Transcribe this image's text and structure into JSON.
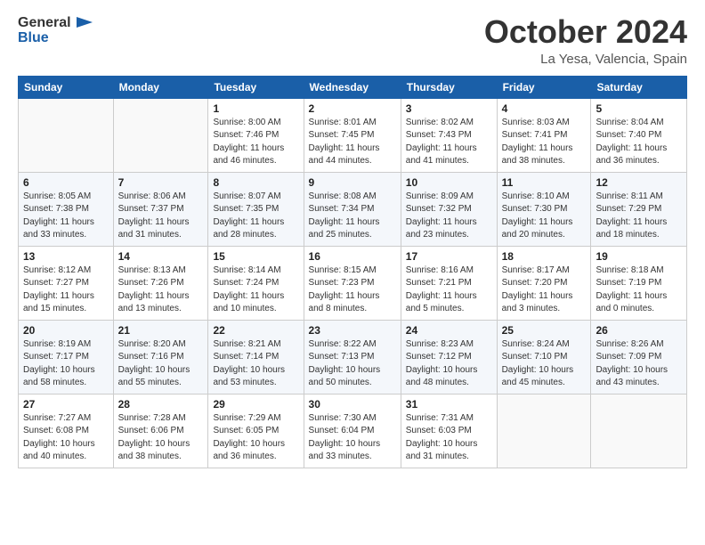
{
  "header": {
    "logo_general": "General",
    "logo_blue": "Blue",
    "month_title": "October 2024",
    "location": "La Yesa, Valencia, Spain"
  },
  "days_of_week": [
    "Sunday",
    "Monday",
    "Tuesday",
    "Wednesday",
    "Thursday",
    "Friday",
    "Saturday"
  ],
  "weeks": [
    [
      {
        "day": "",
        "info": ""
      },
      {
        "day": "",
        "info": ""
      },
      {
        "day": "1",
        "info": "Sunrise: 8:00 AM\nSunset: 7:46 PM\nDaylight: 11 hours\nand 46 minutes."
      },
      {
        "day": "2",
        "info": "Sunrise: 8:01 AM\nSunset: 7:45 PM\nDaylight: 11 hours\nand 44 minutes."
      },
      {
        "day": "3",
        "info": "Sunrise: 8:02 AM\nSunset: 7:43 PM\nDaylight: 11 hours\nand 41 minutes."
      },
      {
        "day": "4",
        "info": "Sunrise: 8:03 AM\nSunset: 7:41 PM\nDaylight: 11 hours\nand 38 minutes."
      },
      {
        "day": "5",
        "info": "Sunrise: 8:04 AM\nSunset: 7:40 PM\nDaylight: 11 hours\nand 36 minutes."
      }
    ],
    [
      {
        "day": "6",
        "info": "Sunrise: 8:05 AM\nSunset: 7:38 PM\nDaylight: 11 hours\nand 33 minutes."
      },
      {
        "day": "7",
        "info": "Sunrise: 8:06 AM\nSunset: 7:37 PM\nDaylight: 11 hours\nand 31 minutes."
      },
      {
        "day": "8",
        "info": "Sunrise: 8:07 AM\nSunset: 7:35 PM\nDaylight: 11 hours\nand 28 minutes."
      },
      {
        "day": "9",
        "info": "Sunrise: 8:08 AM\nSunset: 7:34 PM\nDaylight: 11 hours\nand 25 minutes."
      },
      {
        "day": "10",
        "info": "Sunrise: 8:09 AM\nSunset: 7:32 PM\nDaylight: 11 hours\nand 23 minutes."
      },
      {
        "day": "11",
        "info": "Sunrise: 8:10 AM\nSunset: 7:30 PM\nDaylight: 11 hours\nand 20 minutes."
      },
      {
        "day": "12",
        "info": "Sunrise: 8:11 AM\nSunset: 7:29 PM\nDaylight: 11 hours\nand 18 minutes."
      }
    ],
    [
      {
        "day": "13",
        "info": "Sunrise: 8:12 AM\nSunset: 7:27 PM\nDaylight: 11 hours\nand 15 minutes."
      },
      {
        "day": "14",
        "info": "Sunrise: 8:13 AM\nSunset: 7:26 PM\nDaylight: 11 hours\nand 13 minutes."
      },
      {
        "day": "15",
        "info": "Sunrise: 8:14 AM\nSunset: 7:24 PM\nDaylight: 11 hours\nand 10 minutes."
      },
      {
        "day": "16",
        "info": "Sunrise: 8:15 AM\nSunset: 7:23 PM\nDaylight: 11 hours\nand 8 minutes."
      },
      {
        "day": "17",
        "info": "Sunrise: 8:16 AM\nSunset: 7:21 PM\nDaylight: 11 hours\nand 5 minutes."
      },
      {
        "day": "18",
        "info": "Sunrise: 8:17 AM\nSunset: 7:20 PM\nDaylight: 11 hours\nand 3 minutes."
      },
      {
        "day": "19",
        "info": "Sunrise: 8:18 AM\nSunset: 7:19 PM\nDaylight: 11 hours\nand 0 minutes."
      }
    ],
    [
      {
        "day": "20",
        "info": "Sunrise: 8:19 AM\nSunset: 7:17 PM\nDaylight: 10 hours\nand 58 minutes."
      },
      {
        "day": "21",
        "info": "Sunrise: 8:20 AM\nSunset: 7:16 PM\nDaylight: 10 hours\nand 55 minutes."
      },
      {
        "day": "22",
        "info": "Sunrise: 8:21 AM\nSunset: 7:14 PM\nDaylight: 10 hours\nand 53 minutes."
      },
      {
        "day": "23",
        "info": "Sunrise: 8:22 AM\nSunset: 7:13 PM\nDaylight: 10 hours\nand 50 minutes."
      },
      {
        "day": "24",
        "info": "Sunrise: 8:23 AM\nSunset: 7:12 PM\nDaylight: 10 hours\nand 48 minutes."
      },
      {
        "day": "25",
        "info": "Sunrise: 8:24 AM\nSunset: 7:10 PM\nDaylight: 10 hours\nand 45 minutes."
      },
      {
        "day": "26",
        "info": "Sunrise: 8:26 AM\nSunset: 7:09 PM\nDaylight: 10 hours\nand 43 minutes."
      }
    ],
    [
      {
        "day": "27",
        "info": "Sunrise: 7:27 AM\nSunset: 6:08 PM\nDaylight: 10 hours\nand 40 minutes."
      },
      {
        "day": "28",
        "info": "Sunrise: 7:28 AM\nSunset: 6:06 PM\nDaylight: 10 hours\nand 38 minutes."
      },
      {
        "day": "29",
        "info": "Sunrise: 7:29 AM\nSunset: 6:05 PM\nDaylight: 10 hours\nand 36 minutes."
      },
      {
        "day": "30",
        "info": "Sunrise: 7:30 AM\nSunset: 6:04 PM\nDaylight: 10 hours\nand 33 minutes."
      },
      {
        "day": "31",
        "info": "Sunrise: 7:31 AM\nSunset: 6:03 PM\nDaylight: 10 hours\nand 31 minutes."
      },
      {
        "day": "",
        "info": ""
      },
      {
        "day": "",
        "info": ""
      }
    ]
  ]
}
